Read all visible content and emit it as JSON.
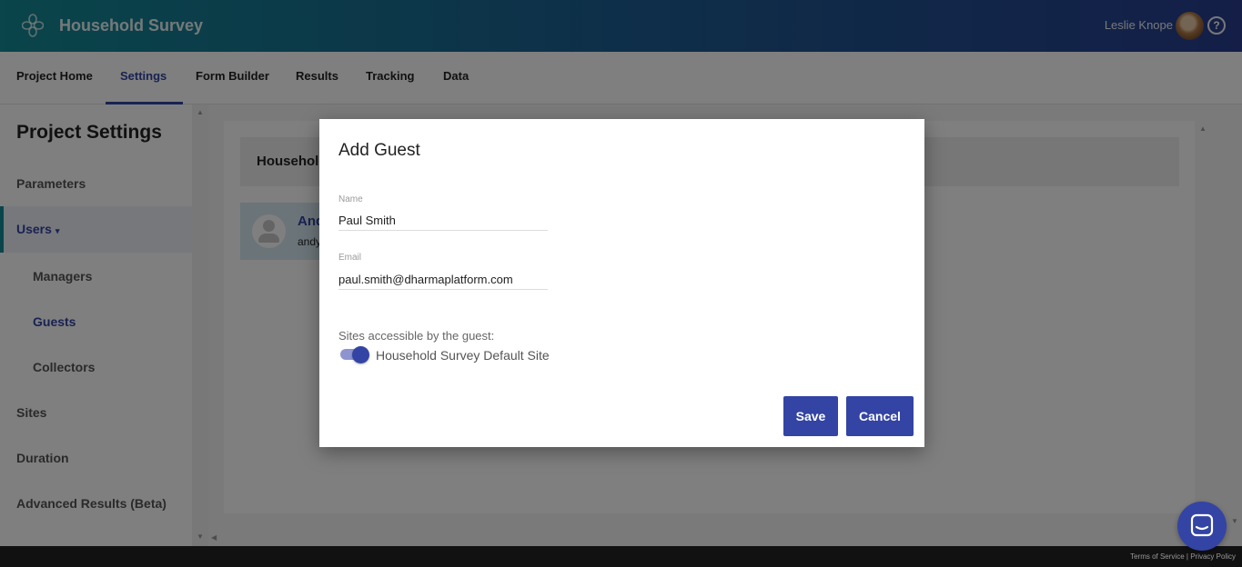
{
  "header": {
    "app_title": "Household Survey",
    "user_name": "Leslie Knope",
    "help_symbol": "?"
  },
  "nav": {
    "tabs": [
      {
        "label": "Project Home"
      },
      {
        "label": "Settings",
        "active": true
      },
      {
        "label": "Form Builder"
      },
      {
        "label": "Results"
      },
      {
        "label": "Tracking"
      },
      {
        "label": "Data"
      }
    ]
  },
  "sidebar": {
    "title": "Project Settings",
    "items": [
      {
        "label": "Parameters"
      },
      {
        "label": "Users"
      },
      {
        "label": "Managers"
      },
      {
        "label": "Guests"
      },
      {
        "label": "Collectors"
      },
      {
        "label": "Sites"
      },
      {
        "label": "Duration"
      },
      {
        "label": "Advanced Results (Beta)"
      }
    ]
  },
  "main": {
    "section_header": "Househol",
    "user_card": {
      "name": "And",
      "email": "andy"
    }
  },
  "modal": {
    "title": "Add Guest",
    "name_label": "Name",
    "name_value": "Paul Smith",
    "email_label": "Email",
    "email_value": "paul.smith@dharmaplatform.com",
    "sites_label": "Sites accessible by the guest:",
    "site_toggle": {
      "label": "Household Survey Default Site",
      "enabled": true
    },
    "save_label": "Save",
    "cancel_label": "Cancel"
  },
  "footer": {
    "terms": "Terms of Service",
    "separator": "|",
    "privacy": "Privacy Policy"
  },
  "colors": {
    "accent": "#3344a4",
    "header_start": "#138a94",
    "header_end": "#283d8f"
  }
}
